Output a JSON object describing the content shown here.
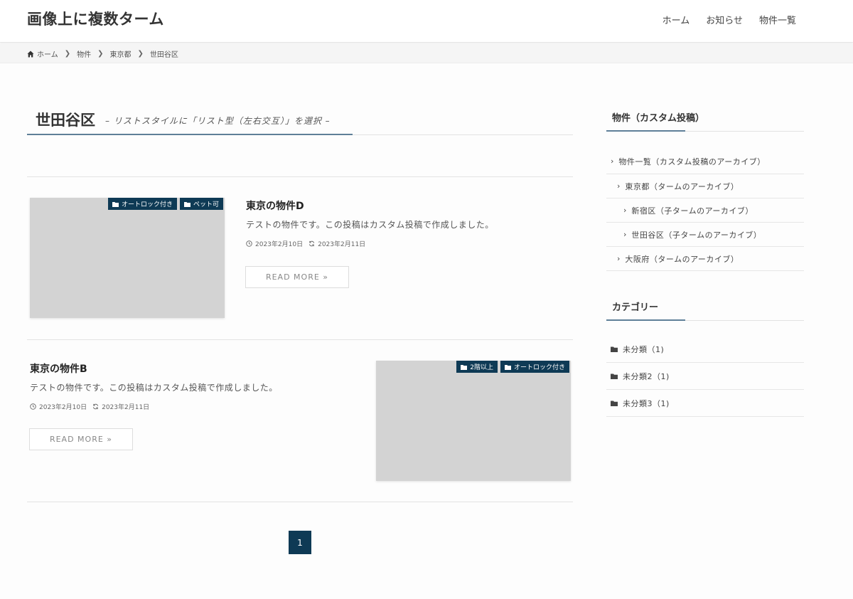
{
  "site": {
    "title": "画像上に複数ターム"
  },
  "nav": {
    "items": [
      "ホーム",
      "お知らせ",
      "物件一覧"
    ]
  },
  "breadcrumb": {
    "items": [
      "ホーム",
      "物件",
      "東京都",
      "世田谷区"
    ]
  },
  "page": {
    "title": "世田谷区",
    "subtitle": "– リストスタイルに「リスト型（左右交互）」を選択 –"
  },
  "posts": [
    {
      "title": "東京の物件D",
      "excerpt": "テストの物件です。この投稿はカスタム投稿で作成しました。",
      "published": "2023年2月10日",
      "updated": "2023年2月11日",
      "tags": [
        "オートロック付き",
        "ペット可"
      ],
      "readmore": "READ MORE »"
    },
    {
      "title": "東京の物件B",
      "excerpt": "テストの物件です。この投稿はカスタム投稿で作成しました。",
      "published": "2023年2月10日",
      "updated": "2023年2月11日",
      "tags": [
        "2階以上",
        "オートロック付き"
      ],
      "readmore": "READ MORE »"
    }
  ],
  "pagination": {
    "current": "1"
  },
  "sidebar": {
    "widget1": {
      "title": "物件（カスタム投稿）",
      "items": [
        "物件一覧（カスタム投稿のアーカイブ）",
        "東京都（タームのアーカイブ）",
        "新宿区（子タームのアーカイブ）",
        "世田谷区（子タームのアーカイブ）",
        "大阪府（タームのアーカイブ）"
      ]
    },
    "widget2": {
      "title": "カテゴリー",
      "items": [
        "未分類（1)",
        "未分類2（1)",
        "未分類3（1)"
      ]
    }
  },
  "colors": {
    "accent": "#0e3a55",
    "underline": "#5f7f98",
    "thumb": "#d3d3d3"
  }
}
